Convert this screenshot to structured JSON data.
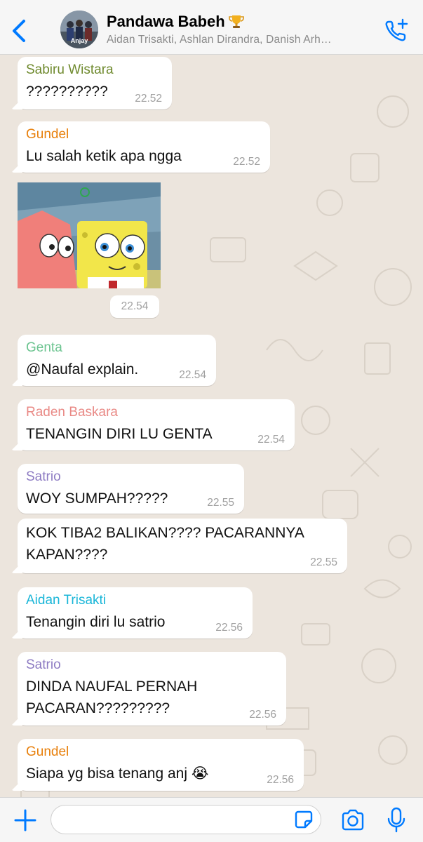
{
  "header": {
    "group_name": "Pandawa Babeh",
    "members": "Aidan Trisakti, Ashlan Dirandra, Danish Arh…",
    "avatar_caption": "Anjay"
  },
  "messages": [
    {
      "sender": "Sabiru Wistara",
      "sender_color": "#6f8a2e",
      "text": "??????????",
      "time": "22.52"
    },
    {
      "sender": "Gundel",
      "sender_color": "#e8800c",
      "text": "Lu salah ketik apa ngga",
      "time": "22.52"
    },
    {
      "image": "spongebob-patrick-gif",
      "time": "22.54"
    },
    {
      "sender": "Genta",
      "sender_color": "#6cc490",
      "text": "@Naufal explain.",
      "time": "22.54"
    },
    {
      "sender": "Raden Baskara",
      "sender_color": "#e98a86",
      "text": "TENANGIN DIRI LU GENTA",
      "time": "22.54"
    },
    {
      "sender": "Satrio",
      "sender_color": "#8e7cc3",
      "text": "WOY SUMPAH?????",
      "time": "22.55"
    },
    {
      "text_lines": [
        "KOK TIBA2 BALIKAN???? PACARANNYA",
        "KAPAN????"
      ],
      "time": "22.55"
    },
    {
      "sender": "Aidan Trisakti",
      "sender_color": "#1ab6d8",
      "text": "Tenangin diri lu satrio",
      "time": "22.56"
    },
    {
      "sender": "Satrio",
      "sender_color": "#8e7cc3",
      "text_lines": [
        "DINDA NAUFAL PERNAH",
        "PACARAN?????????"
      ],
      "time": "22.56"
    },
    {
      "sender": "Gundel",
      "sender_color": "#e8800c",
      "text": "Siapa yg bisa tenang anj",
      "emoji": "😭",
      "time": "22.56"
    }
  ],
  "input": {
    "placeholder": "",
    "value": ""
  },
  "icons": [
    "back-icon",
    "call-add-icon",
    "trophy-icon",
    "plus-icon",
    "sticker-icon",
    "camera-icon",
    "mic-icon"
  ],
  "colors": {
    "accent": "#007aff",
    "bubble": "#ffffff",
    "chat_bg": "#ece5dd",
    "header_bg": "#f6f6f6",
    "time": "#a0a0a0"
  }
}
